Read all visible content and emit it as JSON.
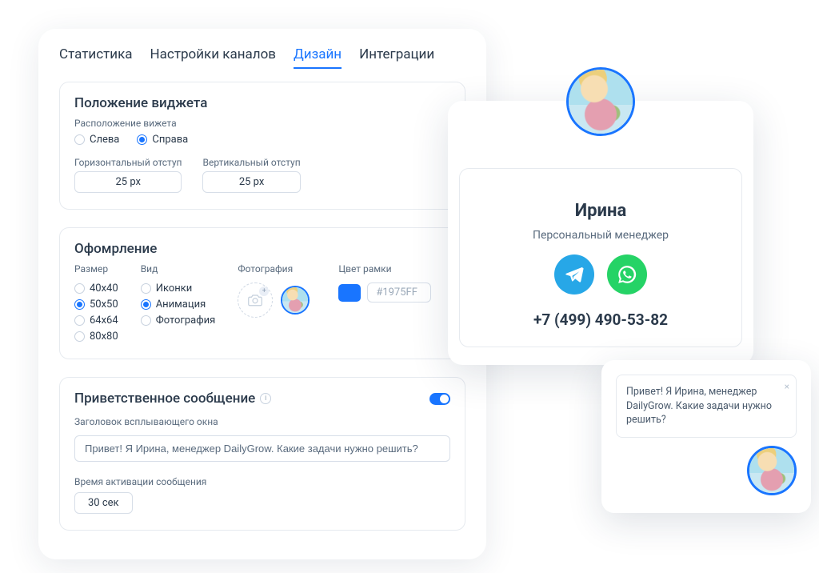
{
  "tabs": {
    "stats": "Статистика",
    "channels": "Настройки каналов",
    "design": "Дизайн",
    "integrations": "Интеграции"
  },
  "position": {
    "title": "Положение виджета",
    "placement_label": "Расположение вижета",
    "options": {
      "left": "Слева",
      "right": "Справа"
    },
    "selected": "right",
    "h_offset_label": "Горизонтальный отступ",
    "v_offset_label": "Вертикальный отступ",
    "h_offset": "25 px",
    "v_offset": "25 px"
  },
  "appearance": {
    "title": "Офомрление",
    "size_label": "Размер",
    "sizes": [
      "40x40",
      "50x50",
      "64x64",
      "80x80"
    ],
    "size_selected": "50x50",
    "type_label": "Вид",
    "types": {
      "icons": "Иконки",
      "animation": "Анимация",
      "photo": "Фотография"
    },
    "type_selected": "animation",
    "photo_label": "Фотография",
    "frame_color_label": "Цвет рамки",
    "frame_color": "#1975FF"
  },
  "greeting": {
    "title": "Приветственное сообщение",
    "enabled": true,
    "header_label": "Заголовок всплывающего окна",
    "header_value": "Привет! Я Ирина, менеджер DailyGrow. Какие задачи нужно решить?",
    "delay_label": "Время активации сообщения",
    "delay_value": "30 сек"
  },
  "widget": {
    "name": "Ирина",
    "role": "Персональный менеджер",
    "phone": "+7 (499) 490-53-82"
  },
  "popup": {
    "text": "Привет! Я Ирина, менеджер DailyGrow. Какие задачи нужно решить?"
  }
}
